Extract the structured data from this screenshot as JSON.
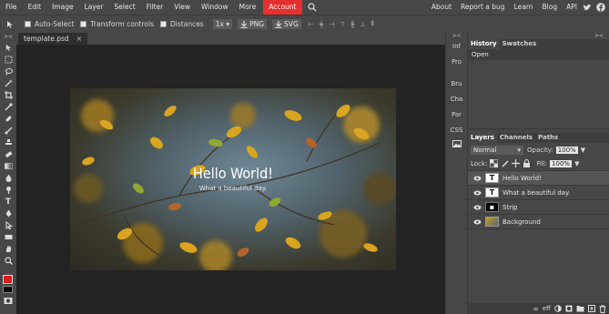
{
  "menu": {
    "items": [
      "File",
      "Edit",
      "Image",
      "Layer",
      "Select",
      "Filter",
      "View",
      "Window",
      "More",
      "Account"
    ],
    "right_links": [
      "About",
      "Report a bug",
      "Learn",
      "Blog",
      "API"
    ]
  },
  "options": {
    "auto_select": "Auto-Select",
    "transform_controls": "Transform controls",
    "distances": "Distances",
    "scale": "1x",
    "export_png": "PNG",
    "export_svg": "SVG"
  },
  "document": {
    "tab_label": "template.psd",
    "title_text": "Hello World!",
    "subtitle_text": "What a beautiful day."
  },
  "mini_panels": [
    "Inf",
    "Pro",
    "Bru",
    "Cha",
    "Par",
    "CSS"
  ],
  "history_panel": {
    "tabs": [
      "History",
      "Swatches"
    ],
    "entries": [
      "Open"
    ]
  },
  "layers_panel": {
    "tabs": [
      "Layers",
      "Channels",
      "Paths"
    ],
    "blend_mode": "Normal",
    "opacity_label": "Opacity:",
    "opacity_value": "100%",
    "lock_label": "Lock:",
    "fill_label": "Fill:",
    "fill_value": "100%",
    "layers": [
      {
        "name": "Hello World!",
        "type": "text",
        "selected": true
      },
      {
        "name": "What a beautiful day.",
        "type": "text",
        "selected": false
      },
      {
        "name": "Strip",
        "type": "shape",
        "selected": false
      },
      {
        "name": "Background",
        "type": "image",
        "selected": false
      }
    ]
  },
  "colors": {
    "accent": "#e62f2f",
    "foreground_swatch": "#e01b1b",
    "background_swatch": "#000000"
  }
}
